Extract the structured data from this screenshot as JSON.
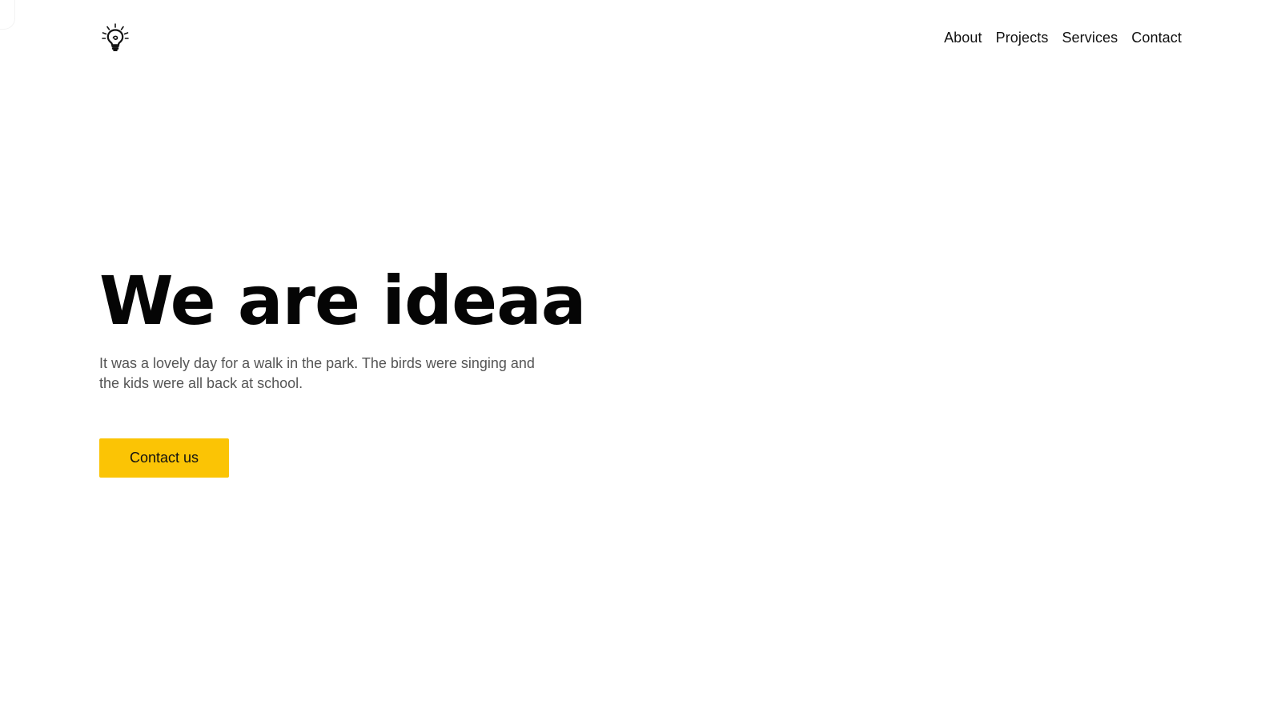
{
  "header": {
    "logo_icon": "lightbulb-icon",
    "nav": [
      {
        "label": "About"
      },
      {
        "label": "Projects"
      },
      {
        "label": "Services"
      },
      {
        "label": "Contact"
      }
    ]
  },
  "hero": {
    "title": "We are ideaa",
    "text": "It was a lovely day for a walk in the park. The birds were singing and the kids were all back at school.",
    "cta_label": "Contact us"
  },
  "colors": {
    "accent": "#fbc405",
    "text": "#111111",
    "muted": "#555555",
    "background": "#ffffff"
  }
}
